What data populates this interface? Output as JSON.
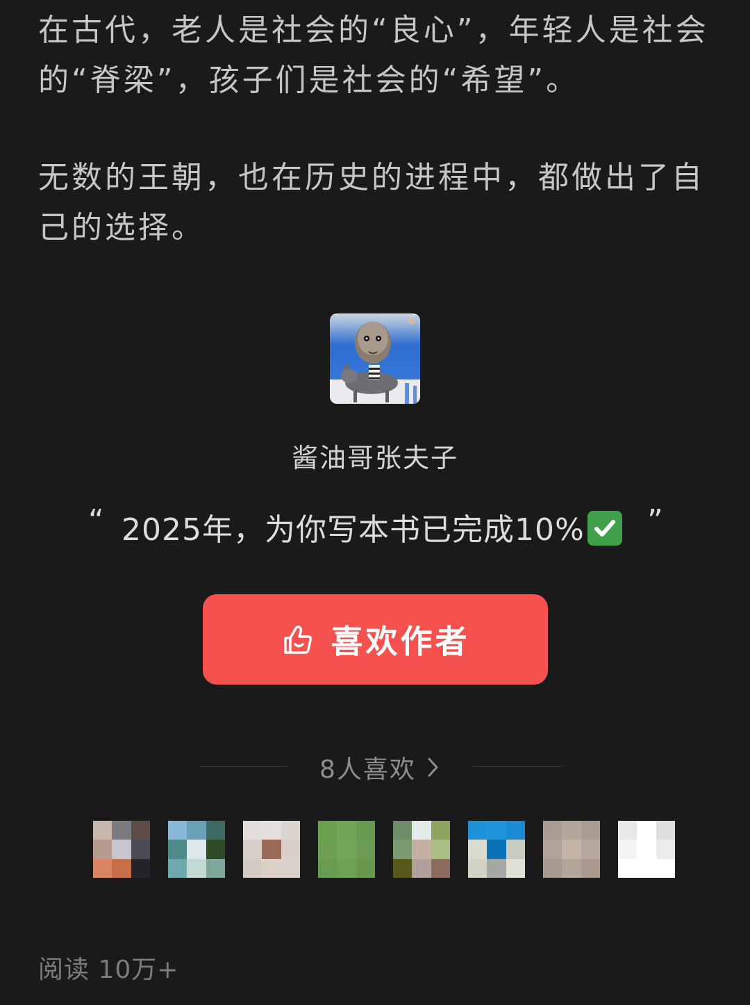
{
  "article": {
    "paragraph_1": "在古代，老人是社会的“良心”，年轻人是社会的“脊梁”，孩子们是社会的“希望”。",
    "paragraph_2": "无数的王朝，也在历史的进程中，都做出了自己的选择。"
  },
  "author": {
    "name": "酱油哥张夫子",
    "avatar_icon": "caricature-riding-bull-avatar",
    "quote_open": "“",
    "quote_text": "2025年，为你写本书已完成10%",
    "quote_emoji": "white-heavy-check-mark-icon",
    "quote_close": "”"
  },
  "like_button": {
    "label": "喜欢作者",
    "icon": "thumbs-up-icon",
    "color": "#f5514e"
  },
  "likes": {
    "count_label": "8人喜欢",
    "icon": "chevron-right-icon"
  },
  "liker_avatars": [
    {
      "colors": [
        "#c7b8ad",
        "#7b7b80",
        "#5e4d46",
        "#b59a8e",
        "#c6c6d0",
        "#4b4b58",
        "#d98562",
        "#c56e48",
        "#262328"
      ]
    },
    {
      "colors": [
        "#8ab8d8",
        "#6ba0b9",
        "#3d6a63",
        "#4f8a8b",
        "#dfe7ea",
        "#2e4a27",
        "#6ea9b0",
        "#c3d9d4",
        "#7ea79c"
      ]
    },
    {
      "colors": [
        "#e1ddd9",
        "#e6e1dd",
        "#dcd4cf",
        "#d8cfc9",
        "#9b6b58",
        "#d9cfca",
        "#d5cbc5",
        "#dccfc7",
        "#d9d2cc"
      ]
    },
    {
      "colors": [
        "#6aa14f",
        "#70a656",
        "#67994f",
        "#6e9f53",
        "#72a85a",
        "#6b9b55",
        "#699c50",
        "#6ea253",
        "#68974e"
      ]
    },
    {
      "colors": [
        "#6f8c6a",
        "#e4ecea",
        "#8da35f",
        "#7d9b73",
        "#c4b1a2",
        "#a9bf86",
        "#56591a",
        "#b09f9b",
        "#8e6c5d"
      ]
    },
    {
      "colors": [
        "#1e92d9",
        "#1f95de",
        "#1b8ad4",
        "#d9dbd0",
        "#0c72b8",
        "#c6ccbf",
        "#d2d2c6",
        "#a4a9a4",
        "#e0e0d5"
      ]
    },
    {
      "colors": [
        "#a99c91",
        "#b3a79d",
        "#a89b90",
        "#b0a296",
        "#c4b4a6",
        "#b5a79b",
        "#a69a8f",
        "#b3a59a",
        "#a9998c"
      ]
    },
    {
      "colors": [
        "#e9e9e9",
        "#ffffff",
        "#dedede",
        "#f4f4f4",
        "#ffffff",
        "#ececec",
        "#ffffff",
        "#ffffff",
        "#ffffff"
      ]
    }
  ],
  "footer": {
    "read_count": "阅读 10万+"
  }
}
